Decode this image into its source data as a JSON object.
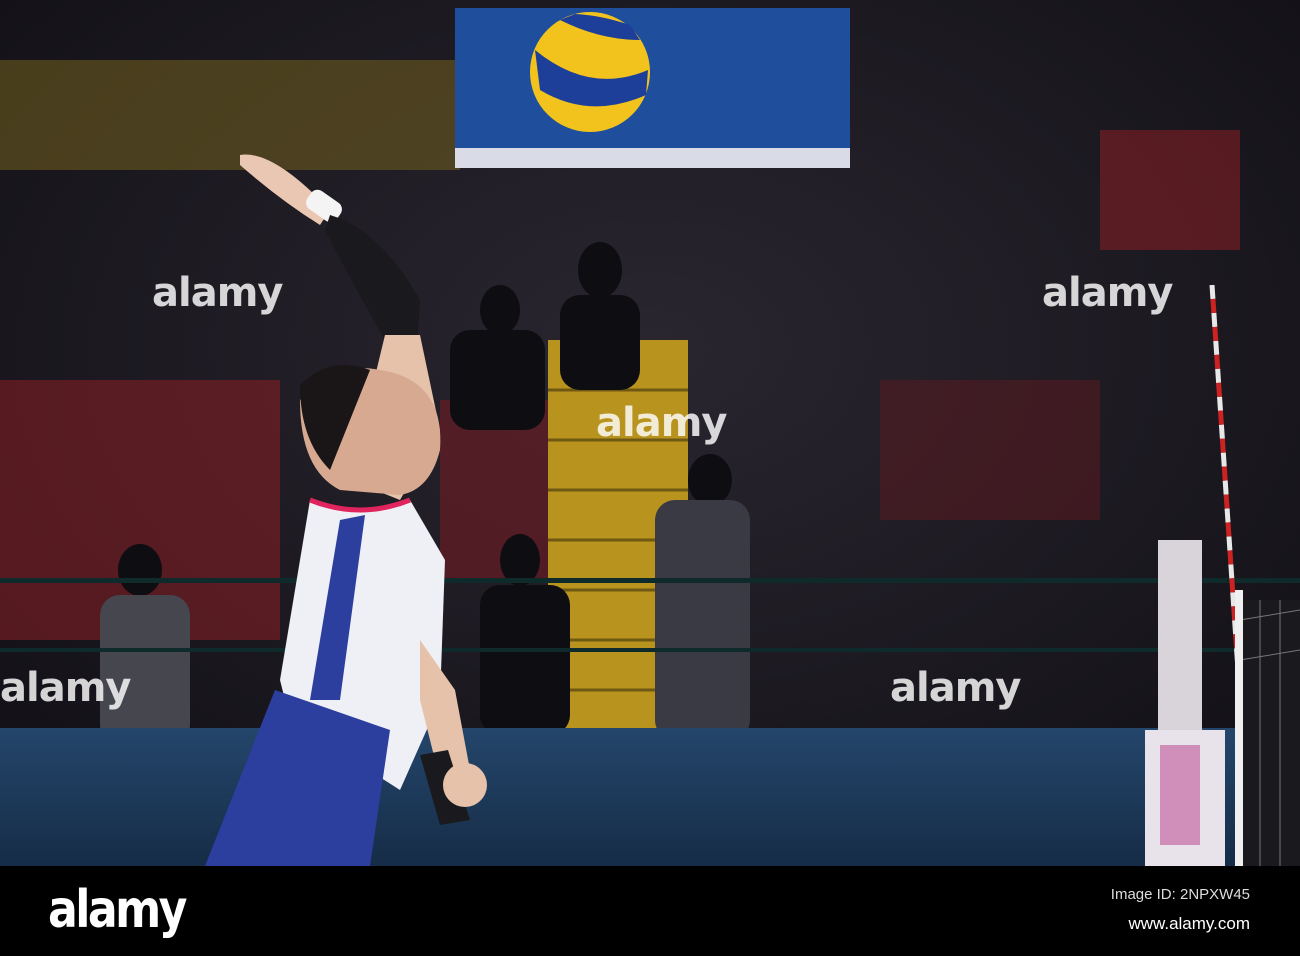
{
  "watermark": {
    "text": "alamy"
  },
  "footer": {
    "logo": "alamy",
    "image_id": "Image ID: 2NPXW45",
    "url": "www.alamy.com"
  },
  "colors": {
    "crowd": "#1c1a22",
    "seats_yellow": "#c9a21e",
    "banner_blue": "#1f4f9c",
    "wall_blue": "#1d3b5e",
    "ball_yellow": "#f2c31c",
    "ball_blue": "#1e3f99",
    "jersey_blue": "#2c3f9e"
  }
}
